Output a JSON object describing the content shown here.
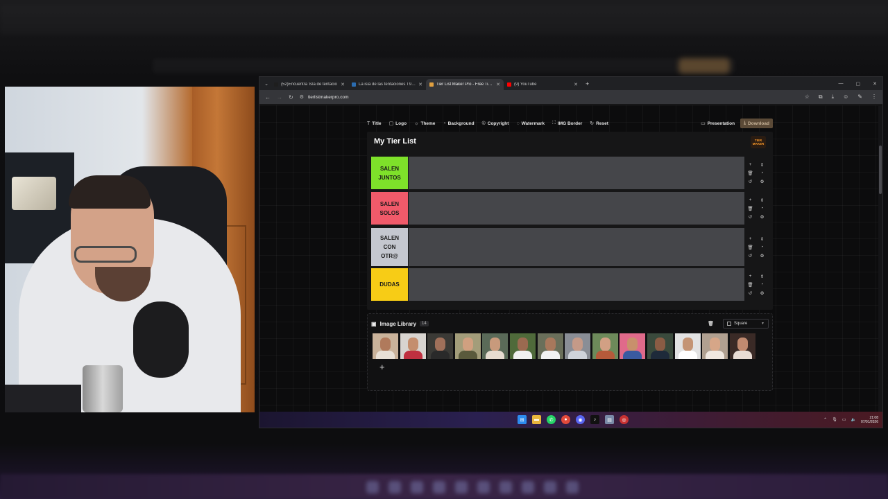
{
  "browser": {
    "tabs": [
      {
        "label": "(52)Encuentra 'isla de tentacio",
        "favicon_color": "#1e1e1e",
        "active": false
      },
      {
        "label": "La isla de las tentaciones T9 | M",
        "favicon_color": "#2b6cb0",
        "active": false
      },
      {
        "label": "Tier List Maker Pro - Free Tier L",
        "favicon_color": "#e0a040",
        "active": true
      },
      {
        "label": "(9) YouTube",
        "favicon_color": "#ff0000",
        "active": false
      }
    ],
    "url": "tierlistmakerpro.com"
  },
  "toolbar": {
    "items": [
      {
        "label": "Title",
        "icon": "T"
      },
      {
        "label": "Logo",
        "icon": "▢"
      },
      {
        "label": "Theme",
        "icon": "☼"
      },
      {
        "label": "Background",
        "icon": "◔"
      },
      {
        "label": "Copyright",
        "icon": "©"
      },
      {
        "label": "Watermark",
        "icon": "◌"
      },
      {
        "label": "IMG Border",
        "icon": "⛶"
      },
      {
        "label": "Reset",
        "icon": "↻"
      }
    ],
    "presentation_label": "Presentation",
    "download_label": "Download"
  },
  "tierlist": {
    "title": "My Tier List",
    "logo_text": "TIER\nMAKER",
    "tiers": [
      {
        "label": "SALEN\nJUNTOS",
        "color": "#7ee12a"
      },
      {
        "label": "SALEN\nSOLOS",
        "color": "#f05a6a"
      },
      {
        "label": "SALEN\nCON\nOTR@",
        "color": "#c4c7cf"
      },
      {
        "label": "DUDAS",
        "color": "#f7cc16"
      }
    ]
  },
  "library": {
    "title": "Image Library",
    "count": "14",
    "shape": "Square",
    "thumbs": [
      {
        "bg": "#c9b29a",
        "skin": "#b07a5c",
        "shirt": "#e8e0d6"
      },
      {
        "bg": "#d8d4d0",
        "skin": "#c48e6e",
        "shirt": "#c03040"
      },
      {
        "bg": "#3b3a36",
        "skin": "#a0705a",
        "shirt": "#2a2a2a"
      },
      {
        "bg": "#a39d7a",
        "skin": "#d0a080",
        "shirt": "#5a5a3c"
      },
      {
        "bg": "#5a6a58",
        "skin": "#c89a7c",
        "shirt": "#e6dcd0"
      },
      {
        "bg": "#4f6a3a",
        "skin": "#9a6a50",
        "shirt": "#f0f0f0"
      },
      {
        "bg": "#6a6f5a",
        "skin": "#a8785c",
        "shirt": "#f2f2f2"
      },
      {
        "bg": "#8a8e96",
        "skin": "#c49a88",
        "shirt": "#cfd3da"
      },
      {
        "bg": "#6d8a5a",
        "skin": "#d2a084",
        "shirt": "#b65a3a"
      },
      {
        "bg": "#e06a8a",
        "skin": "#c8906c",
        "shirt": "#3a5aa0"
      },
      {
        "bg": "#3a4a3c",
        "skin": "#8a5c44",
        "shirt": "#1e2a3a"
      },
      {
        "bg": "#e2e2e2",
        "skin": "#c49474",
        "shirt": "#ffffff"
      },
      {
        "bg": "#b0a090",
        "skin": "#d6a688",
        "shirt": "#f0e8e0"
      },
      {
        "bg": "#3a2a26",
        "skin": "#c08a70",
        "shirt": "#e8dcd4"
      }
    ]
  },
  "taskbar": {
    "time": "21:08",
    "date": "07/01/2026"
  }
}
